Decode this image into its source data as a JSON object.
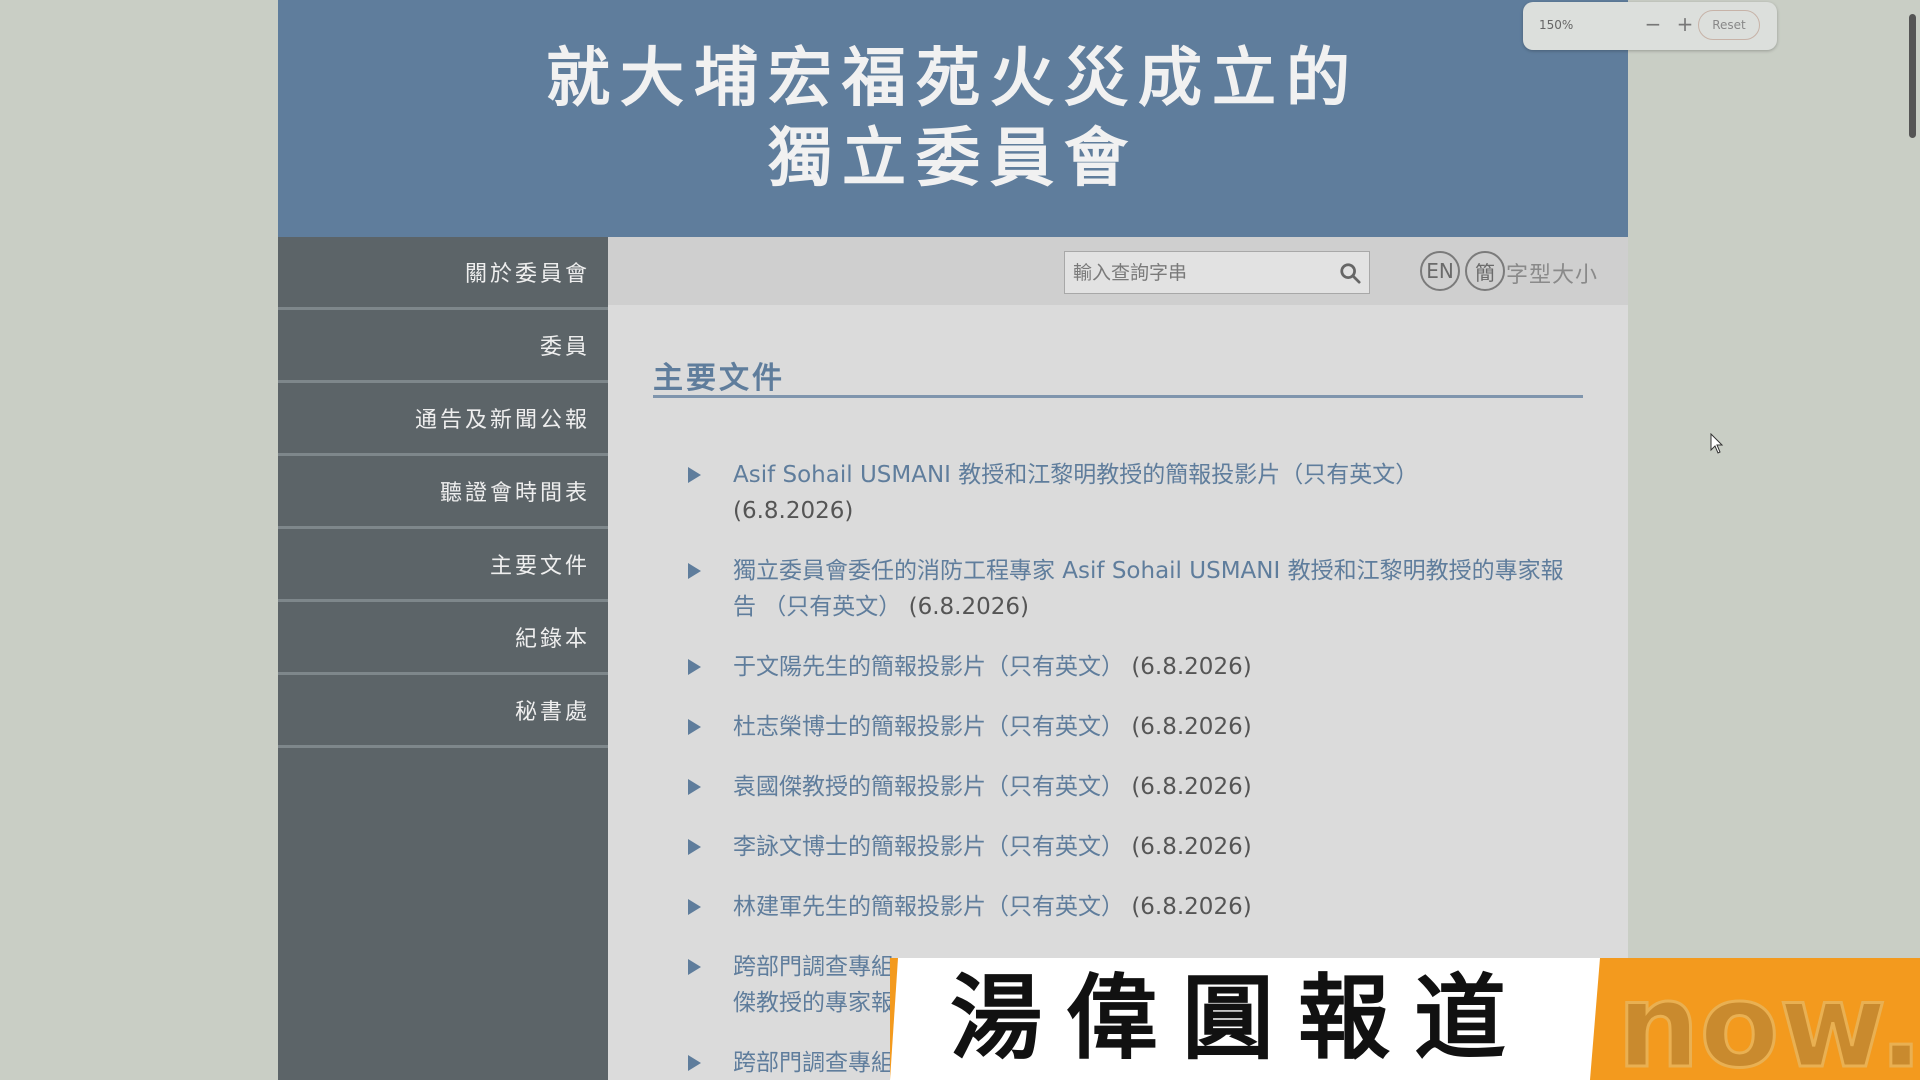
{
  "banner": {
    "line1": "就大埔宏福苑火災成立的",
    "line2": "獨立委員會"
  },
  "sidebar": {
    "items": [
      {
        "label": "關於委員會"
      },
      {
        "label": "委員"
      },
      {
        "label": "通告及新聞公報"
      },
      {
        "label": "聽證會時間表"
      },
      {
        "label": "主要文件"
      },
      {
        "label": "紀錄本"
      },
      {
        "label": "秘書處"
      }
    ]
  },
  "topbar": {
    "search_placeholder": "輸入查詢字串",
    "lang_en": "EN",
    "lang_sc": "簡",
    "font_size_label": "字型大小"
  },
  "main": {
    "section_title": "主要文件",
    "documents": [
      {
        "title": "Asif Sohail USMANI 教授和江黎明教授的簡報投影片（只有英文）",
        "date": "(6.8.2026)"
      },
      {
        "title": "獨立委員會委任的消防工程專家 Asif Sohail USMANI 教授和江黎明教授的專家報告 （只有英文）",
        "date": "(6.8.2026)"
      },
      {
        "title": "于文陽先生的簡報投影片（只有英文）",
        "date": "(6.8.2026)"
      },
      {
        "title": "杜志榮博士的簡報投影片（只有英文）",
        "date": "(6.8.2026)"
      },
      {
        "title": "袁國傑教授的簡報投影片（只有英文）",
        "date": "(6.8.2026)"
      },
      {
        "title": "李詠文博士的簡報投影片（只有英文）",
        "date": "(6.8.2026)"
      },
      {
        "title": "林建軍先生的簡報投影片（只有英文）",
        "date": "(6.8.2026)"
      },
      {
        "title": "跨部門調查專組",
        "date": ""
      },
      {
        "title": "跨部門調查專組",
        "date": ""
      }
    ],
    "doc8_line2": "傑教授的專家報"
  },
  "zoom": {
    "percent": "150%",
    "minus": "−",
    "plus": "+",
    "reset": "Reset"
  },
  "news_caption": "湯偉圓報道",
  "logo_text": "now.",
  "colors": {
    "banner": "#5f7d9c",
    "sidebar": "#5c6468",
    "accent": "#5f7d9c",
    "ticker": "#f39a1e"
  }
}
